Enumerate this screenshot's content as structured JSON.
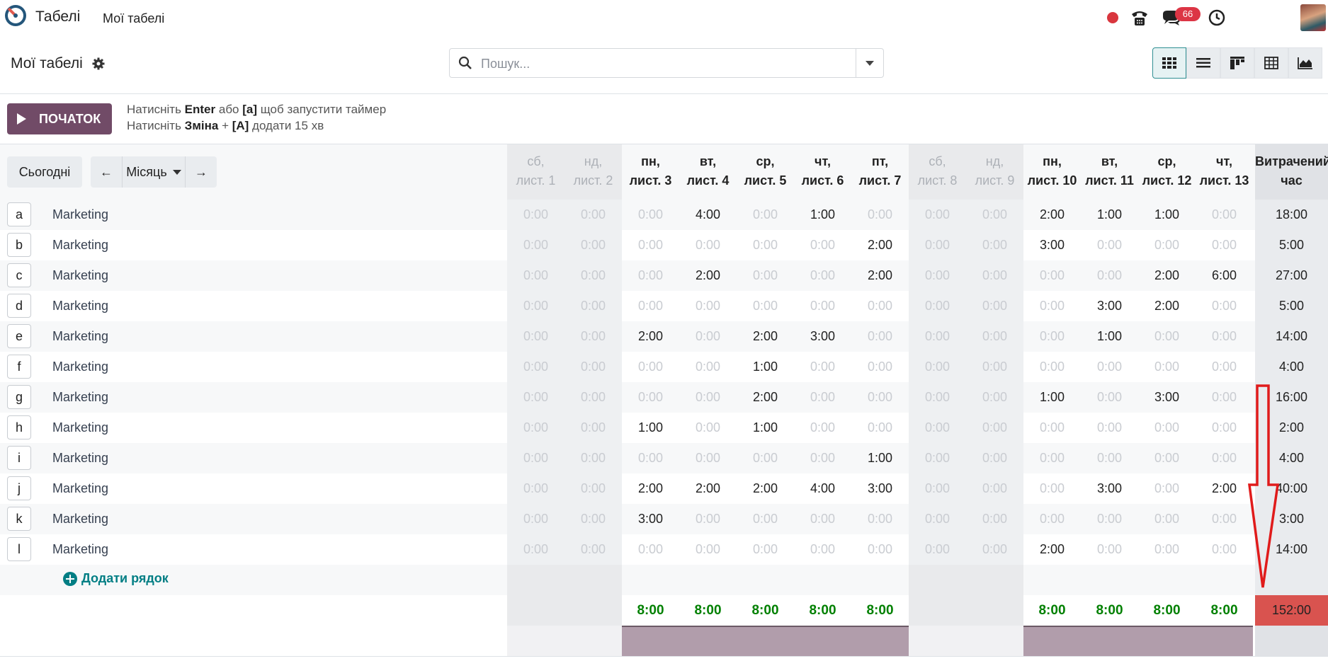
{
  "topbar": {
    "app_name": "Табелі",
    "menu_item": "Мої табелі",
    "messages_badge": "66",
    "icons": [
      "app-logo-icon",
      "record-dot-icon",
      "phone-icon",
      "chat-icon",
      "clock-icon",
      "user-avatar"
    ]
  },
  "control_panel": {
    "title": "Мої табелі",
    "search_placeholder": "Пошук...",
    "views": [
      "grid-view",
      "list-view",
      "kanban-view",
      "pivot-view",
      "graph-view"
    ],
    "active_view": "grid-view"
  },
  "timer": {
    "start_label": "ПОЧАТОК",
    "hint1_pre": "Натисніть ",
    "hint1_key": "Enter",
    "hint1_mid": " або ",
    "hint1_key2": "[a]",
    "hint1_post": " щоб запустити таймер",
    "hint2_pre": "Натисніть ",
    "hint2_key": "Зміна",
    "hint2_mid": " + ",
    "hint2_key2": "[A]",
    "hint2_post": " додати 15 хв"
  },
  "nav": {
    "today": "Сьогодні",
    "range": "Місяць",
    "prev": "←",
    "next": "→"
  },
  "days": [
    {
      "d1": "сб,",
      "d2": "лист. 1",
      "weekend": true
    },
    {
      "d1": "нд,",
      "d2": "лист. 2",
      "weekend": true
    },
    {
      "d1": "пн,",
      "d2": "лист. 3",
      "weekend": false
    },
    {
      "d1": "вт,",
      "d2": "лист. 4",
      "weekend": false
    },
    {
      "d1": "ср,",
      "d2": "лист. 5",
      "weekend": false
    },
    {
      "d1": "чт,",
      "d2": "лист. 6",
      "weekend": false
    },
    {
      "d1": "пт,",
      "d2": "лист. 7",
      "weekend": false
    },
    {
      "d1": "сб,",
      "d2": "лист. 8",
      "weekend": true
    },
    {
      "d1": "нд,",
      "d2": "лист. 9",
      "weekend": true
    },
    {
      "d1": "пн,",
      "d2": "лист. 10",
      "weekend": false
    },
    {
      "d1": "вт,",
      "d2": "лист. 11",
      "weekend": false
    },
    {
      "d1": "ср,",
      "d2": "лист. 12",
      "weekend": false
    },
    {
      "d1": "чт,",
      "d2": "лист. 13",
      "weekend": false
    }
  ],
  "total_header": {
    "l1": "Витрачений",
    "l2": "час"
  },
  "rows": [
    {
      "letter": "a",
      "project": "Marketing",
      "cells": [
        "0:00",
        "0:00",
        "0:00",
        "4:00",
        "0:00",
        "1:00",
        "0:00",
        "0:00",
        "0:00",
        "2:00",
        "1:00",
        "1:00",
        "0:00"
      ],
      "total": "18:00"
    },
    {
      "letter": "b",
      "project": "Marketing",
      "cells": [
        "0:00",
        "0:00",
        "0:00",
        "0:00",
        "0:00",
        "0:00",
        "2:00",
        "0:00",
        "0:00",
        "3:00",
        "0:00",
        "0:00",
        "0:00"
      ],
      "total": "5:00"
    },
    {
      "letter": "c",
      "project": "Marketing",
      "cells": [
        "0:00",
        "0:00",
        "0:00",
        "2:00",
        "0:00",
        "0:00",
        "2:00",
        "0:00",
        "0:00",
        "0:00",
        "0:00",
        "2:00",
        "6:00"
      ],
      "total": "27:00"
    },
    {
      "letter": "d",
      "project": "Marketing",
      "cells": [
        "0:00",
        "0:00",
        "0:00",
        "0:00",
        "0:00",
        "0:00",
        "0:00",
        "0:00",
        "0:00",
        "0:00",
        "3:00",
        "2:00",
        "0:00"
      ],
      "total": "5:00"
    },
    {
      "letter": "e",
      "project": "Marketing",
      "cells": [
        "0:00",
        "0:00",
        "2:00",
        "0:00",
        "2:00",
        "3:00",
        "0:00",
        "0:00",
        "0:00",
        "0:00",
        "1:00",
        "0:00",
        "0:00"
      ],
      "total": "14:00"
    },
    {
      "letter": "f",
      "project": "Marketing",
      "cells": [
        "0:00",
        "0:00",
        "0:00",
        "0:00",
        "1:00",
        "0:00",
        "0:00",
        "0:00",
        "0:00",
        "0:00",
        "0:00",
        "0:00",
        "0:00"
      ],
      "total": "4:00"
    },
    {
      "letter": "g",
      "project": "Marketing",
      "cells": [
        "0:00",
        "0:00",
        "0:00",
        "0:00",
        "2:00",
        "0:00",
        "0:00",
        "0:00",
        "0:00",
        "1:00",
        "0:00",
        "3:00",
        "0:00"
      ],
      "total": "16:00"
    },
    {
      "letter": "h",
      "project": "Marketing",
      "cells": [
        "0:00",
        "0:00",
        "1:00",
        "0:00",
        "1:00",
        "0:00",
        "0:00",
        "0:00",
        "0:00",
        "0:00",
        "0:00",
        "0:00",
        "0:00"
      ],
      "total": "2:00"
    },
    {
      "letter": "i",
      "project": "Marketing",
      "cells": [
        "0:00",
        "0:00",
        "0:00",
        "0:00",
        "0:00",
        "0:00",
        "1:00",
        "0:00",
        "0:00",
        "0:00",
        "0:00",
        "0:00",
        "0:00"
      ],
      "total": "4:00"
    },
    {
      "letter": "j",
      "project": "Marketing",
      "cells": [
        "0:00",
        "0:00",
        "2:00",
        "2:00",
        "2:00",
        "4:00",
        "3:00",
        "0:00",
        "0:00",
        "0:00",
        "3:00",
        "0:00",
        "2:00"
      ],
      "total": "40:00"
    },
    {
      "letter": "k",
      "project": "Marketing",
      "cells": [
        "0:00",
        "0:00",
        "3:00",
        "0:00",
        "0:00",
        "0:00",
        "0:00",
        "0:00",
        "0:00",
        "0:00",
        "0:00",
        "0:00",
        "0:00"
      ],
      "total": "3:00"
    },
    {
      "letter": "l",
      "project": "Marketing",
      "cells": [
        "0:00",
        "0:00",
        "0:00",
        "0:00",
        "0:00",
        "0:00",
        "0:00",
        "0:00",
        "0:00",
        "2:00",
        "0:00",
        "0:00",
        "0:00"
      ],
      "total": "14:00"
    }
  ],
  "add_row": "Додати рядок",
  "footer_totals": [
    "",
    "",
    "8:00",
    "8:00",
    "8:00",
    "8:00",
    "8:00",
    "",
    "",
    "8:00",
    "8:00",
    "8:00",
    "8:00"
  ],
  "grand_total": "152:00",
  "colors": {
    "accent": "#714b67",
    "teal": "#017e84",
    "green": "#008000",
    "danger": "#d9534f",
    "annotation": "#e01b1b"
  }
}
